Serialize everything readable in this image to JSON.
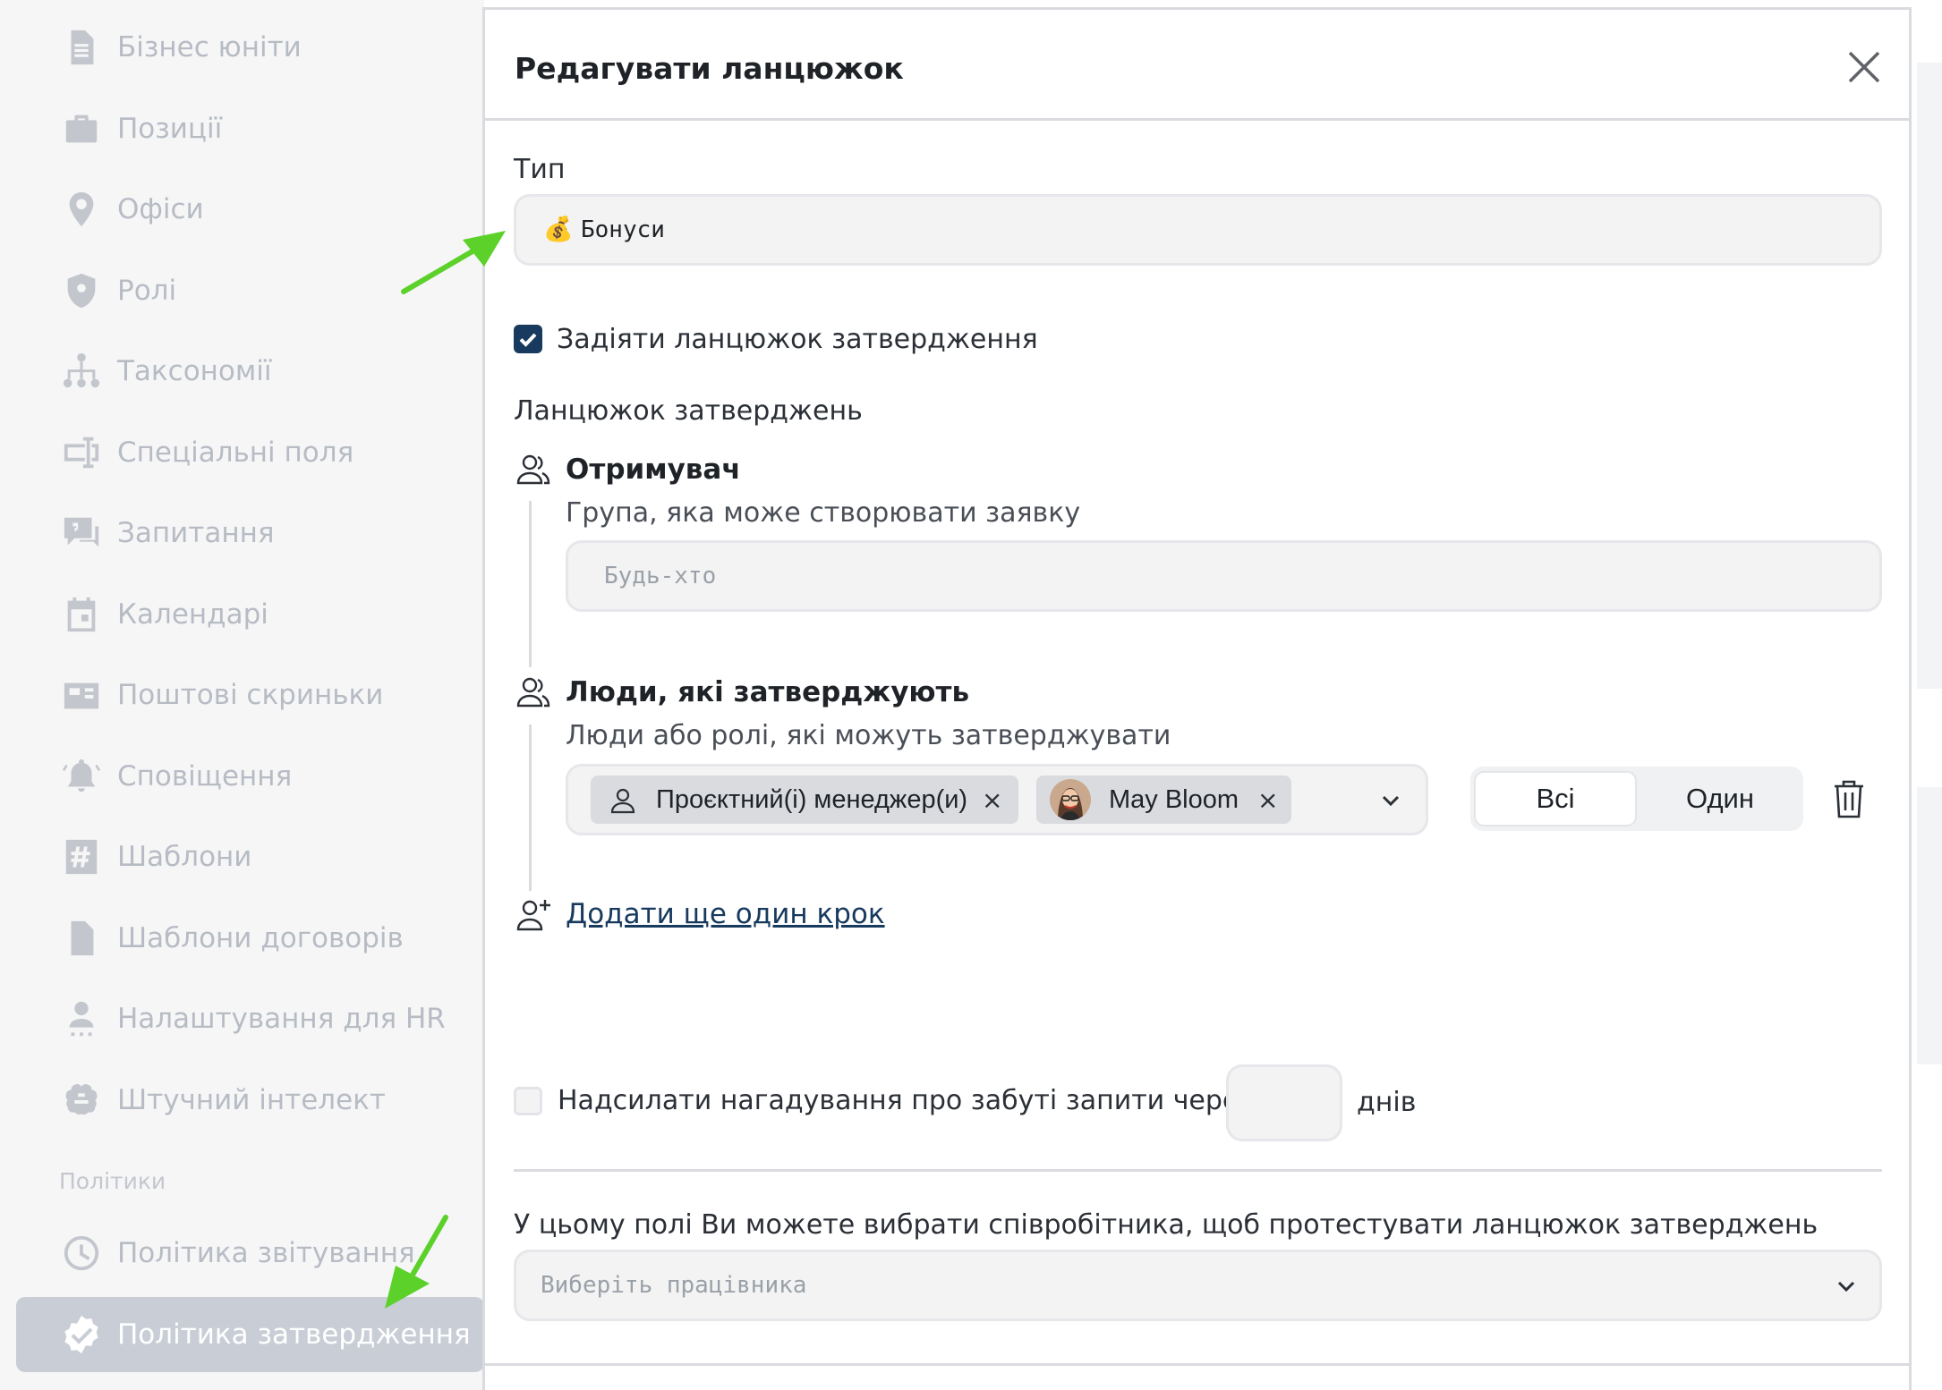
{
  "sidebar": {
    "items": [
      {
        "label": "Бізнес юніти",
        "icon": "document-icon"
      },
      {
        "label": "Позиції",
        "icon": "briefcase-icon"
      },
      {
        "label": "Офіси",
        "icon": "location-pin-icon"
      },
      {
        "label": "Ролі",
        "icon": "shield-icon"
      },
      {
        "label": "Таксономії",
        "icon": "hierarchy-icon"
      },
      {
        "label": "Спеціальні поля",
        "icon": "custom-field-icon"
      },
      {
        "label": "Запитання",
        "icon": "question-chat-icon"
      },
      {
        "label": "Календарі",
        "icon": "calendar-icon"
      },
      {
        "label": "Поштові скриньки",
        "icon": "mailbox-icon"
      },
      {
        "label": "Сповіщення",
        "icon": "bell-icon"
      },
      {
        "label": "Шаблони",
        "icon": "hashtag-icon"
      },
      {
        "label": "Шаблони договорів",
        "icon": "contract-icon"
      },
      {
        "label": "Налаштування для HR",
        "icon": "hr-person-icon"
      },
      {
        "label": "Штучний інтелект",
        "icon": "brain-icon"
      }
    ],
    "section_label": "Політики",
    "policy_items": [
      {
        "label": "Політика звітування",
        "icon": "clock-icon"
      },
      {
        "label": "Політика затвердження",
        "icon": "check-badge-icon",
        "active": true
      }
    ]
  },
  "modal": {
    "title": "Редагувати ланцюжок",
    "type_label": "Тип",
    "type_emoji": "💰",
    "type_value": "Бонуси",
    "enable_chain_label": "Задіяти ланцюжок затвердження",
    "enable_chain_checked": true,
    "chain_section_label": "Ланцюжок затверджень",
    "recipient": {
      "title": "Отримувач",
      "description": "Група, яка може створювати заявку",
      "placeholder": "Будь-хто"
    },
    "approvers": {
      "title": "Люди, які затверджують",
      "description": "Люди або ролі, які можуть затверджувати",
      "chips": [
        {
          "label": "Проєктний(і) менеджер(и)",
          "kind": "role"
        },
        {
          "label": "May Bloom",
          "kind": "person"
        }
      ],
      "remove_symbol": "×",
      "mode_options": [
        "Всі",
        "Один"
      ],
      "mode_selected": "Всі"
    },
    "add_step_label": "Додати ще один крок",
    "reminder": {
      "label": "Надсилати нагадування про забуті запити через",
      "days_value": "",
      "unit": "днів",
      "checked": false
    },
    "test_label": "У цьому полі Ви можете вибрати співробітника, щоб протестувати ланцюжок затверджень",
    "employee_placeholder": "Виберіть працівника"
  },
  "colors": {
    "accent_dark_blue": "#173a5e",
    "annotation_arrow": "#5bd12a",
    "sidebar_active_bg": "#c9ced6"
  }
}
